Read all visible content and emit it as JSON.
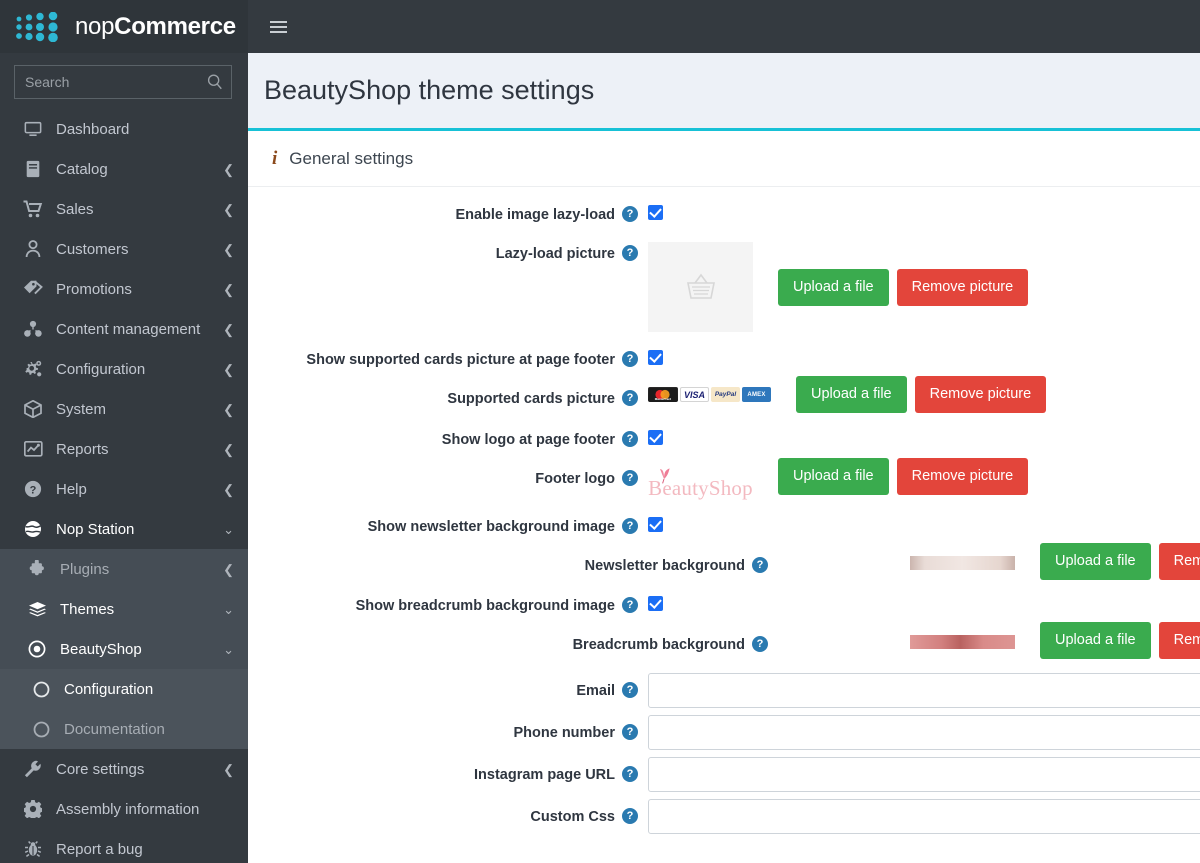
{
  "brand": {
    "name_light": "nop",
    "name_bold": "Commerce",
    "logo_icon": "dot-grid-logo"
  },
  "search": {
    "placeholder": "Search",
    "value": "",
    "icon": "search-icon"
  },
  "sidebar": {
    "items": [
      {
        "label": "Dashboard",
        "icon": "monitor-icon",
        "caret": "",
        "level": 0,
        "state": "normal"
      },
      {
        "label": "Catalog",
        "icon": "book-icon",
        "caret": "❮",
        "level": 0,
        "state": "normal"
      },
      {
        "label": "Sales",
        "icon": "cart-icon",
        "caret": "❮",
        "level": 0,
        "state": "normal"
      },
      {
        "label": "Customers",
        "icon": "user-icon",
        "caret": "❮",
        "level": 0,
        "state": "normal"
      },
      {
        "label": "Promotions",
        "icon": "tag-icon",
        "caret": "❮",
        "level": 0,
        "state": "normal"
      },
      {
        "label": "Content management",
        "icon": "nodes-icon",
        "caret": "❮",
        "level": 0,
        "state": "normal"
      },
      {
        "label": "Configuration",
        "icon": "gears-icon",
        "caret": "❮",
        "level": 0,
        "state": "normal"
      },
      {
        "label": "System",
        "icon": "box-icon",
        "caret": "❮",
        "level": 0,
        "state": "normal"
      },
      {
        "label": "Reports",
        "icon": "chart-icon",
        "caret": "❮",
        "level": 0,
        "state": "normal"
      },
      {
        "label": "Help",
        "icon": "question-icon",
        "caret": "❮",
        "level": 0,
        "state": "normal"
      },
      {
        "label": "Nop Station",
        "icon": "globe-icon",
        "caret": "⌄",
        "level": 0,
        "state": "strong"
      },
      {
        "label": "Plugins",
        "icon": "puzzle-icon",
        "caret": "❮",
        "level": 1,
        "state": "dim"
      },
      {
        "label": "Themes",
        "icon": "layers-icon",
        "caret": "⌄",
        "level": 1,
        "state": "strong"
      },
      {
        "label": "BeautyShop",
        "icon": "radio-dot-icon",
        "caret": "⌄",
        "level": 1,
        "state": "strong"
      },
      {
        "label": "Configuration",
        "icon": "circle-icon",
        "caret": "",
        "level": 2,
        "state": "active"
      },
      {
        "label": "Documentation",
        "icon": "circle-icon",
        "caret": "",
        "level": 2,
        "state": "dim"
      },
      {
        "label": "Core settings",
        "icon": "wrench-icon",
        "caret": "❮",
        "level": 0,
        "state": "normal"
      },
      {
        "label": "Assembly information",
        "icon": "gear-icon",
        "caret": "",
        "level": 0,
        "state": "normal"
      },
      {
        "label": "Report a bug",
        "icon": "bug-icon",
        "caret": "",
        "level": 0,
        "state": "normal"
      }
    ]
  },
  "topbar": {
    "menu_toggle_icon": "hamburger-icon"
  },
  "page": {
    "title": "BeautyShop theme settings"
  },
  "panel": {
    "title": "General settings",
    "icon": "info-icon",
    "accent_color": "#17c1d6"
  },
  "buttons": {
    "upload": "Upload a file",
    "remove": "Remove picture",
    "upload_color": "#3aab4e",
    "remove_color": "#e3453b"
  },
  "help_icon": "?",
  "fields": [
    {
      "label": "Enable image lazy-load",
      "type": "checkbox",
      "checked": true
    },
    {
      "label": "Lazy-load picture",
      "type": "picture-empty",
      "thumb": "empty-basket-placeholder"
    },
    {
      "label": "Show supported cards picture at page footer",
      "type": "checkbox",
      "checked": true
    },
    {
      "label": "Supported cards picture",
      "type": "picture-cards",
      "cards": [
        "MasterCard",
        "VISA",
        "PayPal",
        "AMEX"
      ]
    },
    {
      "label": "Show logo at page footer",
      "type": "checkbox",
      "checked": true
    },
    {
      "label": "Footer logo",
      "type": "picture-logo",
      "logo_text": "BeautyShop",
      "logo_color": "#f3b9c0"
    },
    {
      "label": "Show newsletter background image",
      "type": "checkbox",
      "checked": true
    },
    {
      "label": "Newsletter background",
      "type": "picture-strip",
      "strip": "newsletter"
    },
    {
      "label": "Show breadcrumb background image",
      "type": "checkbox",
      "checked": true
    },
    {
      "label": "Breadcrumb background",
      "type": "picture-strip",
      "strip": "breadcrumb"
    },
    {
      "label": "Email",
      "type": "text",
      "value": ""
    },
    {
      "label": "Phone number",
      "type": "text",
      "value": ""
    },
    {
      "label": "Instagram page URL",
      "type": "text",
      "value": ""
    },
    {
      "label": "Custom Css",
      "type": "text",
      "value": ""
    }
  ]
}
